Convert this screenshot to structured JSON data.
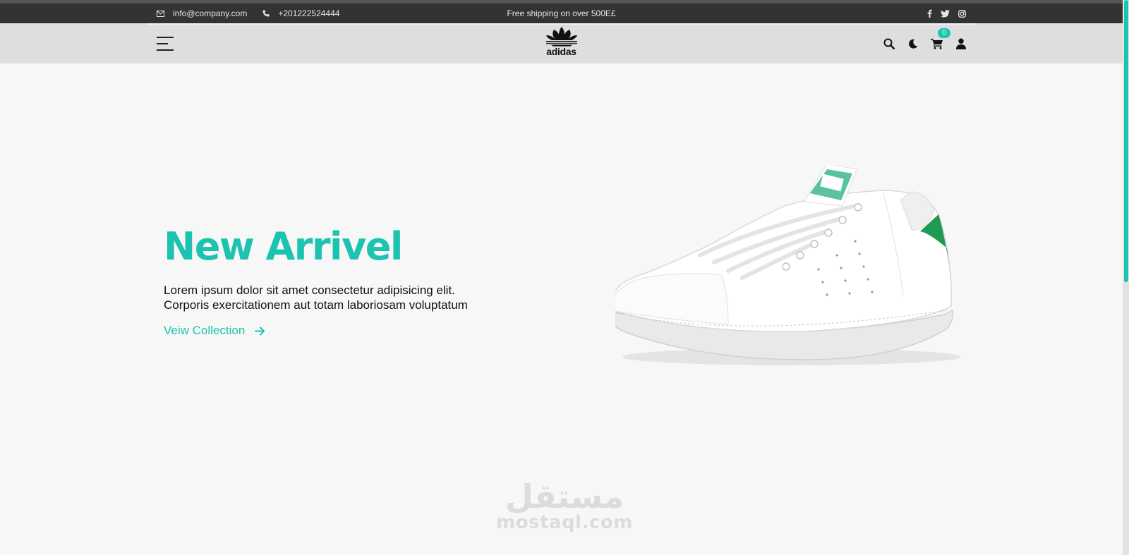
{
  "topbar": {
    "email": "info@company.com",
    "phone": "+201222524444",
    "shipping": "Free shipping on over 500E£",
    "social": [
      "facebook-icon",
      "twitter-icon",
      "instagram-icon"
    ]
  },
  "navbar": {
    "brand": "adidas",
    "cart_count": "0",
    "icons": [
      "menu-icon",
      "search-icon",
      "moon-icon",
      "cart-icon",
      "user-icon"
    ]
  },
  "hero": {
    "title": "New Arrivel",
    "description": "Lorem ipsum dolor sit amet consectetur adipisicing elit. Corporis exercitationem aut totam laboriosam voluptatum",
    "link_label": "Veiw Collection"
  },
  "watermark": {
    "arabic": "مستقل",
    "latin": "mostaql.com"
  },
  "colors": {
    "accent": "#1bc3b0",
    "topbar_bg": "#333333",
    "navbar_bg": "#dedede",
    "page_bg": "#f7f7f7",
    "shoe_heel": "#1f9a52"
  }
}
